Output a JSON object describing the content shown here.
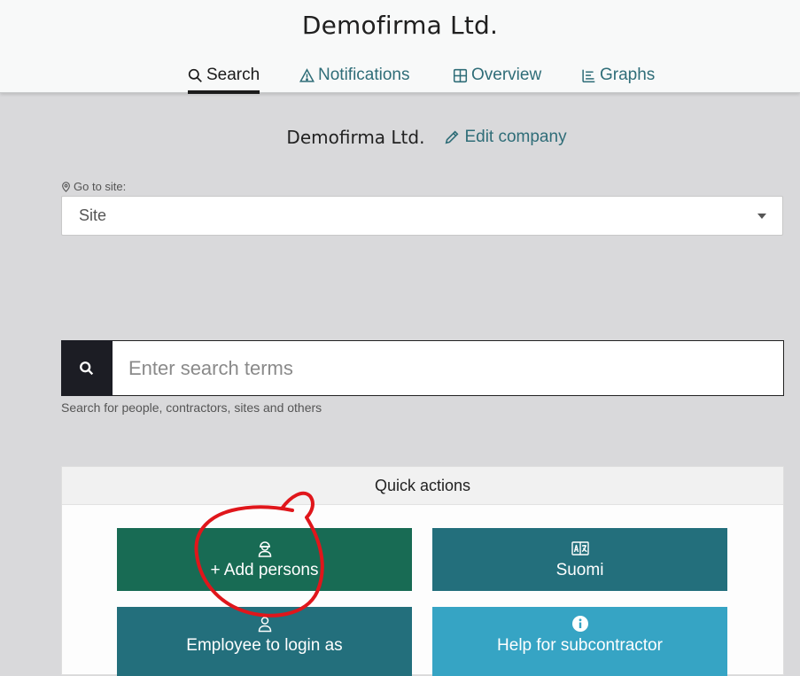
{
  "app": {
    "title": "Demofirma Ltd."
  },
  "tabs": [
    {
      "label": "Search",
      "icon": "search-icon",
      "active": true
    },
    {
      "label": "Notifications",
      "icon": "warning-triangle-icon",
      "active": false
    },
    {
      "label": "Overview",
      "icon": "grid-icon",
      "active": false
    },
    {
      "label": "Graphs",
      "icon": "bar-list-icon",
      "active": false
    }
  ],
  "company": {
    "name": "Demofirma Ltd.",
    "edit_label": "Edit company"
  },
  "site": {
    "label": "Go to site:",
    "selected": "Site"
  },
  "search": {
    "placeholder": "Enter search terms",
    "value": "",
    "hint": "Search for people, contractors, sites and others"
  },
  "quick_actions": {
    "title": "Quick actions",
    "buttons": [
      {
        "label": "+ Add persons",
        "icon": "worker-helmet-icon",
        "color": "#186b54"
      },
      {
        "label": "Suomi",
        "icon": "translate-icon",
        "color": "#236f7c"
      },
      {
        "label": "Employee to login as",
        "icon": "person-icon",
        "color": "#236f7c"
      },
      {
        "label": "Help for subcontractor",
        "icon": "info-icon",
        "color": "#36a4c4"
      }
    ]
  },
  "colors": {
    "accent": "#2f6d78",
    "annotation": "#e0161b"
  }
}
